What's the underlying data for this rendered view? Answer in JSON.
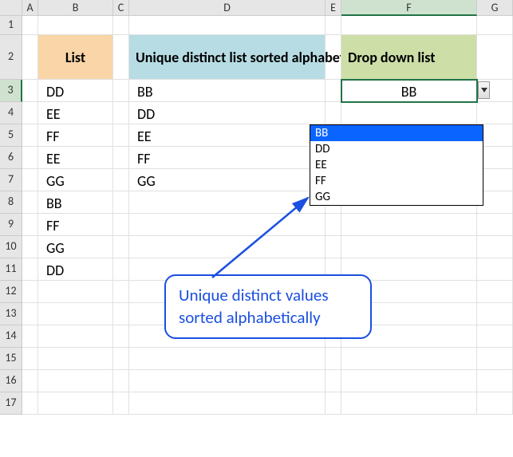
{
  "columns": [
    "A",
    "B",
    "C",
    "D",
    "E",
    "F",
    "G"
  ],
  "activeColumn": "F",
  "activeRow": 3,
  "rowCount": 17,
  "headers": {
    "B": "List",
    "D": "Unique distinct list sorted alphabetically",
    "F": "Drop down list"
  },
  "list": [
    "DD",
    "EE",
    "FF",
    "EE",
    "GG",
    "BB",
    "FF",
    "GG",
    "DD"
  ],
  "unique": [
    "BB",
    "DD",
    "EE",
    "FF",
    "GG"
  ],
  "dropdown": {
    "value": "BB",
    "options": [
      "BB",
      "DD",
      "EE",
      "FF",
      "GG"
    ],
    "highlighted": "BB"
  },
  "callout": {
    "line1": "Unique distinct values",
    "line2": "sorted alphabetically"
  },
  "chart_data": {
    "type": "table",
    "columns": [
      "List",
      "Unique distinct list sorted alphabetically",
      "Drop down list"
    ],
    "list_values": [
      "DD",
      "EE",
      "FF",
      "EE",
      "GG",
      "BB",
      "FF",
      "GG",
      "DD"
    ],
    "unique_values": [
      "BB",
      "DD",
      "EE",
      "FF",
      "GG"
    ],
    "dropdown_selected": "BB"
  }
}
